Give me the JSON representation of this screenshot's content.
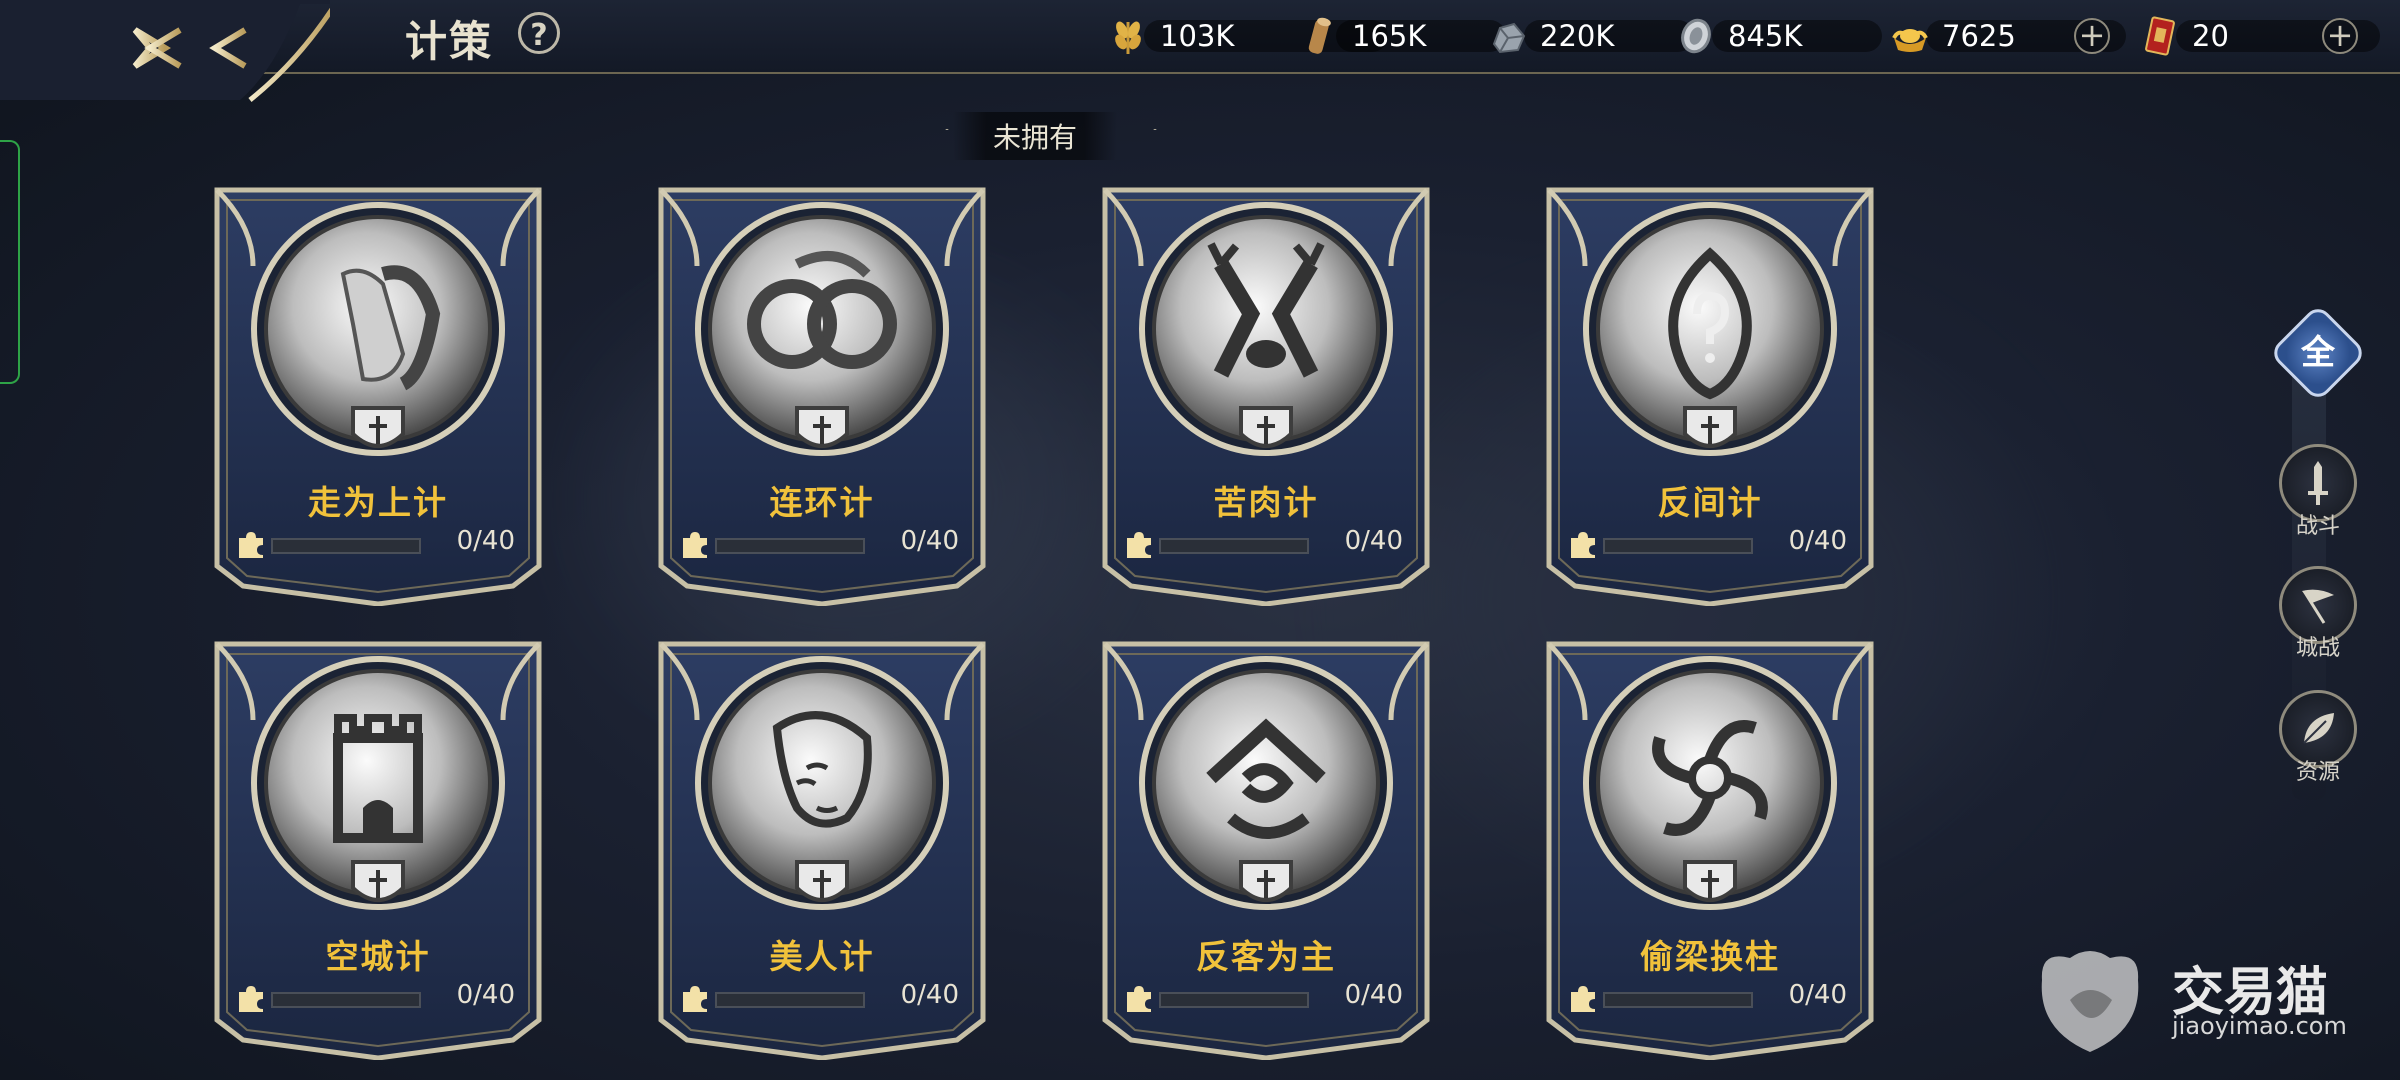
{
  "header": {
    "title": "计策",
    "help_label": "?"
  },
  "resources": [
    {
      "name": "grain-icon",
      "value": "103K"
    },
    {
      "name": "wood-icon",
      "value": "165K"
    },
    {
      "name": "stone-icon",
      "value": "220K"
    },
    {
      "name": "silver-icon",
      "value": "845K"
    },
    {
      "name": "gold-ingot-icon",
      "value": "7625"
    },
    {
      "name": "red-card-icon",
      "value": "20"
    }
  ],
  "section": {
    "label": "未拥有"
  },
  "stratagems": [
    {
      "name": "走为上计",
      "icon": "running-legs-icon",
      "progress": "0/40",
      "fraction": 0
    },
    {
      "name": "连环计",
      "icon": "linked-rings-icon",
      "progress": "0/40",
      "fraction": 0
    },
    {
      "name": "苦肉计",
      "icon": "crossed-antlers-icon",
      "progress": "0/40",
      "fraction": 0
    },
    {
      "name": "反间计",
      "icon": "flame-question-icon",
      "progress": "0/40",
      "fraction": 0
    },
    {
      "name": "空城计",
      "icon": "castle-icon",
      "progress": "0/40",
      "fraction": 0
    },
    {
      "name": "美人计",
      "icon": "beauty-portrait-icon",
      "progress": "0/40",
      "fraction": 0
    },
    {
      "name": "反客为主",
      "icon": "house-swap-icon",
      "progress": "0/40",
      "fraction": 0
    },
    {
      "name": "偷梁换柱",
      "icon": "swirl-vortex-icon",
      "progress": "0/40",
      "fraction": 0
    }
  ],
  "filter_tabs": [
    {
      "label": "全",
      "active": true
    },
    {
      "label": "战斗",
      "active": false
    },
    {
      "label": "城战",
      "active": false
    },
    {
      "label": "资源",
      "active": false
    }
  ],
  "watermark": {
    "brand": "交易猫",
    "url": "jiaoyimao.com"
  },
  "colors": {
    "name_gold": "#f1c23b",
    "card_frame": "#b9b4a2",
    "card_bg": "#22304f",
    "active_tab": "#3d66ad"
  }
}
